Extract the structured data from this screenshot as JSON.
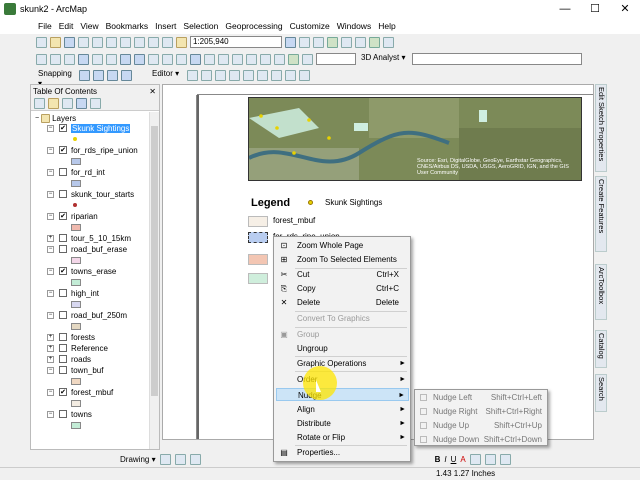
{
  "window": {
    "title": "skunk2 - ArcMap",
    "minimize": "—",
    "maximize": "☐",
    "close": "✕"
  },
  "menu": [
    "File",
    "Edit",
    "View",
    "Bookmarks",
    "Insert",
    "Selection",
    "Geoprocessing",
    "Customize",
    "Windows",
    "Help"
  ],
  "toolbar": {
    "scale": "1:205,940",
    "snapping": "Snapping ▾",
    "editor": "Editor ▾",
    "analyst": "3D Analyst ▾"
  },
  "toc": {
    "title": "Table Of Contents",
    "root": "Layers",
    "layers": [
      {
        "name": "Skunk Sightings",
        "checked": "✔",
        "exp": "−",
        "selected": true,
        "sym": "dot",
        "color": "#e8d200"
      },
      {
        "name": "for_rds_ripe_union",
        "checked": "✔",
        "exp": "−",
        "sym": "box",
        "color": "#b7c8ea"
      },
      {
        "name": "for_rd_int",
        "checked": "",
        "exp": "−",
        "sym": "box",
        "color": "#b7c8ea"
      },
      {
        "name": "skunk_tour_starts",
        "checked": "",
        "exp": "−",
        "sym": "dot",
        "color": "#b03030"
      },
      {
        "name": "riparian",
        "checked": "✔",
        "exp": "−",
        "sym": "box",
        "color": "#f0b9ae"
      },
      {
        "name": "tour_5_10_15km",
        "checked": "",
        "exp": "+",
        "sym": "none"
      },
      {
        "name": "road_buf_erase",
        "checked": "",
        "exp": "−",
        "sym": "box",
        "color": "#f3d6e8"
      },
      {
        "name": "towns_erase",
        "checked": "✔",
        "exp": "−",
        "sym": "box",
        "color": "#c3ecd6"
      },
      {
        "name": "high_int",
        "checked": "",
        "exp": "−",
        "sym": "box",
        "color": "#d8d8f0"
      },
      {
        "name": "road_buf_250m",
        "checked": "",
        "exp": "−",
        "sym": "box",
        "color": "#e4d8c2"
      },
      {
        "name": "forests",
        "checked": "",
        "exp": "+",
        "sym": "none"
      },
      {
        "name": "Reference",
        "checked": "",
        "exp": "+",
        "sym": "none"
      },
      {
        "name": "roads",
        "checked": "",
        "exp": "+",
        "sym": "none"
      },
      {
        "name": "town_buf",
        "checked": "",
        "exp": "−",
        "sym": "box",
        "color": "#f0d8c2"
      },
      {
        "name": "forest_mbuf",
        "checked": "✔",
        "exp": "−",
        "sym": "box",
        "color": "#f3ece2"
      },
      {
        "name": "towns",
        "checked": "",
        "exp": "−",
        "sym": "box",
        "color": "#c3ecd6"
      }
    ]
  },
  "map": {
    "credit": "Source: Esri, DigitalGlobe, GeoEye, Earthstar Geographics, CNES/Airbus DS, USDA, USGS, AeroGRID, IGN, and the GIS User Community"
  },
  "legend": {
    "title": "Legend",
    "items": [
      {
        "label": "Skunk Sightings"
      },
      {
        "label": "forest_mbuf",
        "color": "#f6efe6"
      },
      {
        "label": "for_rds_ripe_union",
        "color": "#b9cdf0"
      },
      {
        "label": "",
        "color": "#f3c6b3"
      },
      {
        "label": "",
        "color": "#cfeedc"
      }
    ]
  },
  "context_menu": {
    "items": [
      {
        "label": "Zoom Whole Page",
        "icon": "⊡",
        "disabled": false
      },
      {
        "label": "Zoom To Selected Elements",
        "icon": "⊞",
        "disabled": false
      },
      {
        "label": "Cut",
        "shortcut": "Ctrl+X",
        "icon": "✂",
        "disabled": false
      },
      {
        "label": "Copy",
        "shortcut": "Ctrl+C",
        "icon": "⎘",
        "disabled": false
      },
      {
        "label": "Delete",
        "shortcut": "Delete",
        "icon": "✕",
        "disabled": false
      },
      {
        "label": "Convert To Graphics",
        "disabled": true
      },
      {
        "label": "Group",
        "icon": "▣",
        "disabled": true
      },
      {
        "label": "Ungroup",
        "disabled": false
      },
      {
        "label": "Graphic Operations",
        "arrow": "►",
        "disabled": false
      },
      {
        "label": "Order",
        "arrow": "►",
        "disabled": false
      },
      {
        "label": "Nudge",
        "arrow": "►",
        "disabled": false,
        "highlight": true
      },
      {
        "label": "Align",
        "arrow": "►",
        "disabled": false
      },
      {
        "label": "Distribute",
        "arrow": "►",
        "disabled": false
      },
      {
        "label": "Rotate or Flip",
        "arrow": "►",
        "disabled": false
      },
      {
        "label": "Properties...",
        "icon": "▤",
        "disabled": false
      }
    ]
  },
  "nudge_menu": {
    "items": [
      {
        "label": "Nudge Left",
        "shortcut": "Shift+Ctrl+Left"
      },
      {
        "label": "Nudge Right",
        "shortcut": "Shift+Ctrl+Right"
      },
      {
        "label": "Nudge Up",
        "shortcut": "Shift+Ctrl+Up"
      },
      {
        "label": "Nudge Down",
        "shortcut": "Shift+Ctrl+Down"
      }
    ]
  },
  "drawing": {
    "label": "Drawing ▾",
    "bold": "B",
    "italic": "I",
    "underline": "U",
    "font_color": "A"
  },
  "status": {
    "coords": "1.43  1.27 Inches"
  },
  "side_tabs": [
    "Edit Sketch Properties",
    "Create Features",
    "ArcToolbox",
    "Catalog",
    "Search"
  ]
}
